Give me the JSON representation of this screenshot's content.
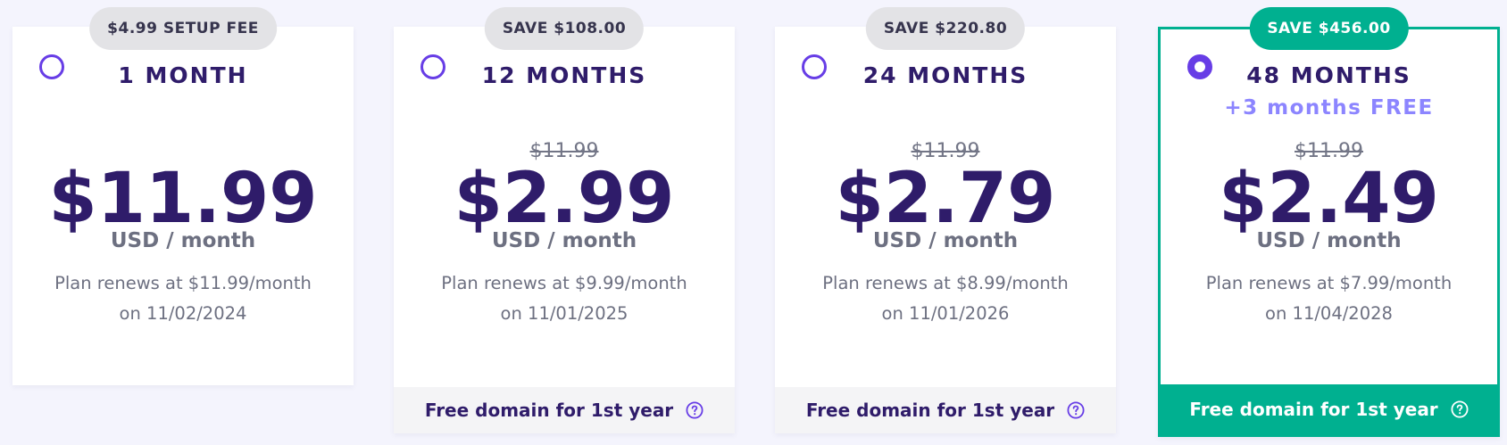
{
  "plans": [
    {
      "badge": "$4.99 SETUP FEE",
      "period": "1 MONTH",
      "bonus": "",
      "old_price": "",
      "price": "$11.99",
      "unit": "USD / month",
      "renew_line1": "Plan renews at $11.99/month",
      "renew_line2": "on 11/02/2024",
      "footer": "",
      "selected": false
    },
    {
      "badge": "SAVE $108.00",
      "period": "12 MONTHS",
      "bonus": "",
      "old_price": "$11.99",
      "price": "$2.99",
      "unit": "USD / month",
      "renew_line1": "Plan renews at $9.99/month",
      "renew_line2": "on 11/01/2025",
      "footer": "Free domain for 1st year",
      "selected": false
    },
    {
      "badge": "SAVE $220.80",
      "period": "24 MONTHS",
      "bonus": "",
      "old_price": "$11.99",
      "price": "$2.79",
      "unit": "USD / month",
      "renew_line1": "Plan renews at $8.99/month",
      "renew_line2": "on 11/01/2026",
      "footer": "Free domain for 1st year",
      "selected": false
    },
    {
      "badge": "SAVE $456.00",
      "period": "48 MONTHS",
      "bonus": "+3 months FREE",
      "old_price": "$11.99",
      "price": "$2.49",
      "unit": "USD / month",
      "renew_line1": "Plan renews at $7.99/month",
      "renew_line2": "on 11/04/2028",
      "footer": "Free domain for 1st year",
      "selected": true
    }
  ],
  "colors": {
    "accent": "#673de6",
    "selected_green": "#00b090",
    "heading": "#2f1c6a",
    "bonus": "#8c85ff",
    "muted": "#6d7081"
  },
  "icons": {
    "radio": "radio-icon",
    "help": "question-circle-icon"
  }
}
